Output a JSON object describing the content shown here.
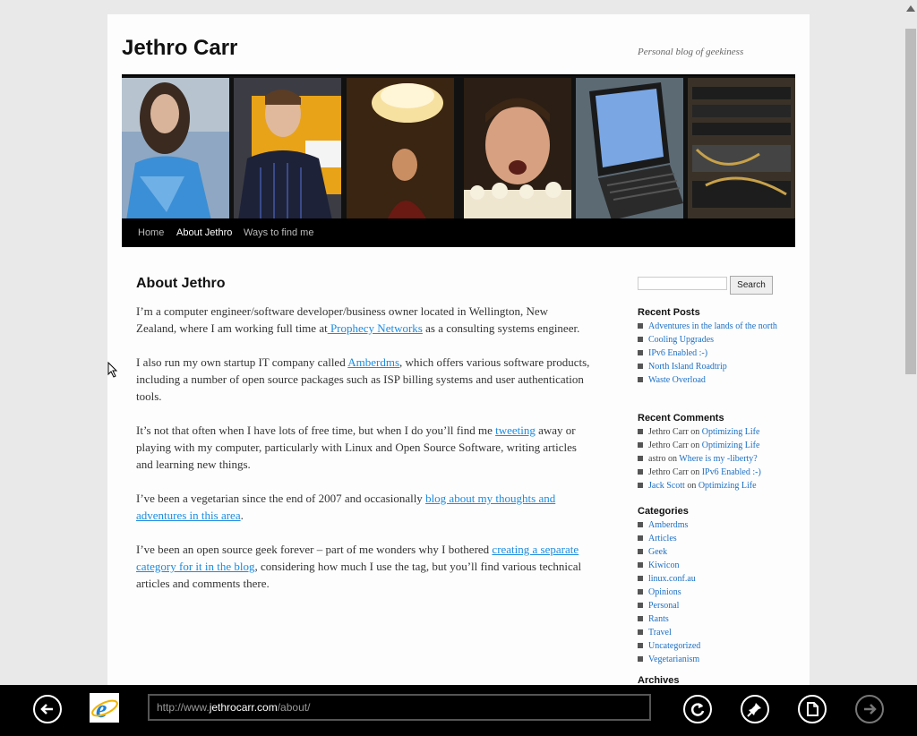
{
  "site": {
    "title": "Jethro Carr",
    "tagline": "Personal blog of geekiness"
  },
  "nav": {
    "items": [
      "Home",
      "About Jethro",
      "Ways to find me"
    ],
    "current": "About Jethro"
  },
  "article": {
    "title": "About Jethro",
    "p1_a": "I’m a computer engineer/software developer/business owner located in Wellington, New Zealand, where I am working full time at",
    "p1_link": " Prophecy Networks",
    "p1_b": " as a consulting systems engineer.",
    "p2_a": "I also run my own startup IT company called ",
    "p2_link": "Amberdms",
    "p2_b": ", which offers various software products, including  a number of open source packages such as ISP billing systems and user authentication tools.",
    "p3_a": "It’s not that often when I have lots of free time, but when I do you’ll find me ",
    "p3_link": "tweeting",
    "p3_b": " away or playing with my computer, particularly with Linux and Open Source Software, writing articles and learning new things.",
    "p4_a": "I’ve been a vegetarian since the end of 2007 and occasionally ",
    "p4_link": "blog about my thoughts and adventures in this area",
    "p4_b": ".",
    "p5_a": "I’ve been an open source geek forever – part of me wonders why I bothered ",
    "p5_link": "creating a separate category for it in the blog",
    "p5_b": ", considering how much I use the tag, but you’ll find various technical articles and comments there."
  },
  "sidebar": {
    "search_button": "Search",
    "recent_posts_title": "Recent Posts",
    "recent_posts": [
      "Adventures in the lands of the north",
      "Cooling Upgrades",
      "IPv6 Enabled :-)",
      "North Island Roadtrip",
      "Waste Overload"
    ],
    "recent_comments_title": "Recent Comments",
    "recent_comments": [
      {
        "author": "Jethro Carr",
        "on": " on ",
        "post": "Optimizing Life"
      },
      {
        "author": "Jethro Carr",
        "on": " on ",
        "post": "Optimizing Life"
      },
      {
        "author": "astro",
        "on": " on ",
        "post": "Where is my -liberty?"
      },
      {
        "author": "Jethro Carr",
        "on": " on ",
        "post": "IPv6 Enabled :-)"
      },
      {
        "author": "Jack Scott",
        "on": " on ",
        "post": "Optimizing Life"
      }
    ],
    "categories_title": "Categories",
    "categories": [
      "Amberdms",
      "Articles",
      "Geek",
      "Kiwicon",
      "linux.conf.au",
      "Opinions",
      "Personal",
      "Rants",
      "Travel",
      "Uncategorized",
      "Vegetarianism"
    ],
    "archives_title": "Archives"
  },
  "browser": {
    "url_prefix": "http://www.",
    "url_host": "jethrocarr.com",
    "url_suffix": "/about/"
  },
  "colors": {
    "link": "#1b8be0",
    "nav_bg": "#000000",
    "page_bg": "#fdfdfd"
  }
}
